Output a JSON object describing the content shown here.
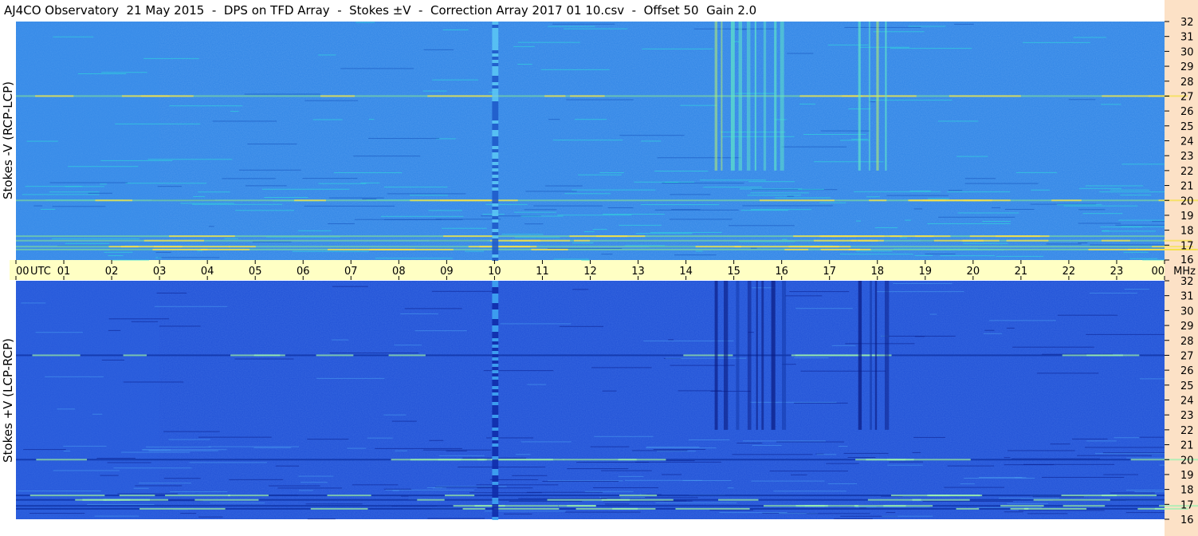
{
  "title": "AJ4CO Observatory  21 May 2015  -  DPS on TFD Array  -  Stokes ±V  -  Correction Array 2017 01 10.csv  -  Offset 50  Gain 2.0",
  "panel_top": {
    "ylabel": "Stokes -V (RCP-LCP)"
  },
  "panel_bottom": {
    "ylabel": "Stokes +V (LCP-RCP)"
  },
  "colors": {
    "axis_band": "#ffffc4",
    "freq_band": "#fce1c6",
    "top_base": "#2d83e6",
    "bottom_base": "#1e4fd6"
  },
  "chart_data": {
    "type": "heatmap",
    "title": "AJ4CO Observatory  21 May 2015  -  DPS on TFD Array  -  Stokes ±V  -  Correction Array 2017 01 10.csv  -  Offset 50  Gain 2.0",
    "x_axis": {
      "unit_label": "UTC",
      "tick_labels": [
        "00",
        "01",
        "02",
        "03",
        "04",
        "05",
        "06",
        "07",
        "08",
        "09",
        "10",
        "11",
        "12",
        "13",
        "14",
        "15",
        "16",
        "17",
        "18",
        "19",
        "20",
        "21",
        "22",
        "23",
        "00"
      ],
      "range_hours": [
        0,
        24
      ]
    },
    "y_axis": {
      "unit_label": "MHz",
      "tick_labels": [
        "16",
        "17",
        "18",
        "19",
        "20",
        "21",
        "22",
        "23",
        "24",
        "25",
        "26",
        "27",
        "28",
        "29",
        "30",
        "31",
        "32"
      ],
      "range_mhz": [
        16,
        32
      ]
    },
    "panels": [
      {
        "name": "Stokes -V (RCP-LCP)",
        "emission": "positive",
        "base_color": "#2d83e6"
      },
      {
        "name": "Stokes +V (LCP-RCP)",
        "emission": "negative",
        "base_color": "#1e4fd6"
      }
    ],
    "features": {
      "wideband_stripe_utc": [
        9.95,
        10.08
      ],
      "bursts": [
        {
          "utc_start": 14.6,
          "utc_end": 16.2,
          "mhz_min": 22,
          "mhz_max": 32
        },
        {
          "utc_start": 17.6,
          "utc_end": 18.2,
          "mhz_min": 22,
          "mhz_max": 32
        }
      ],
      "interference_mhz": [
        16.7,
        16.9,
        17.3,
        17.6,
        20.0,
        27.0
      ]
    }
  }
}
